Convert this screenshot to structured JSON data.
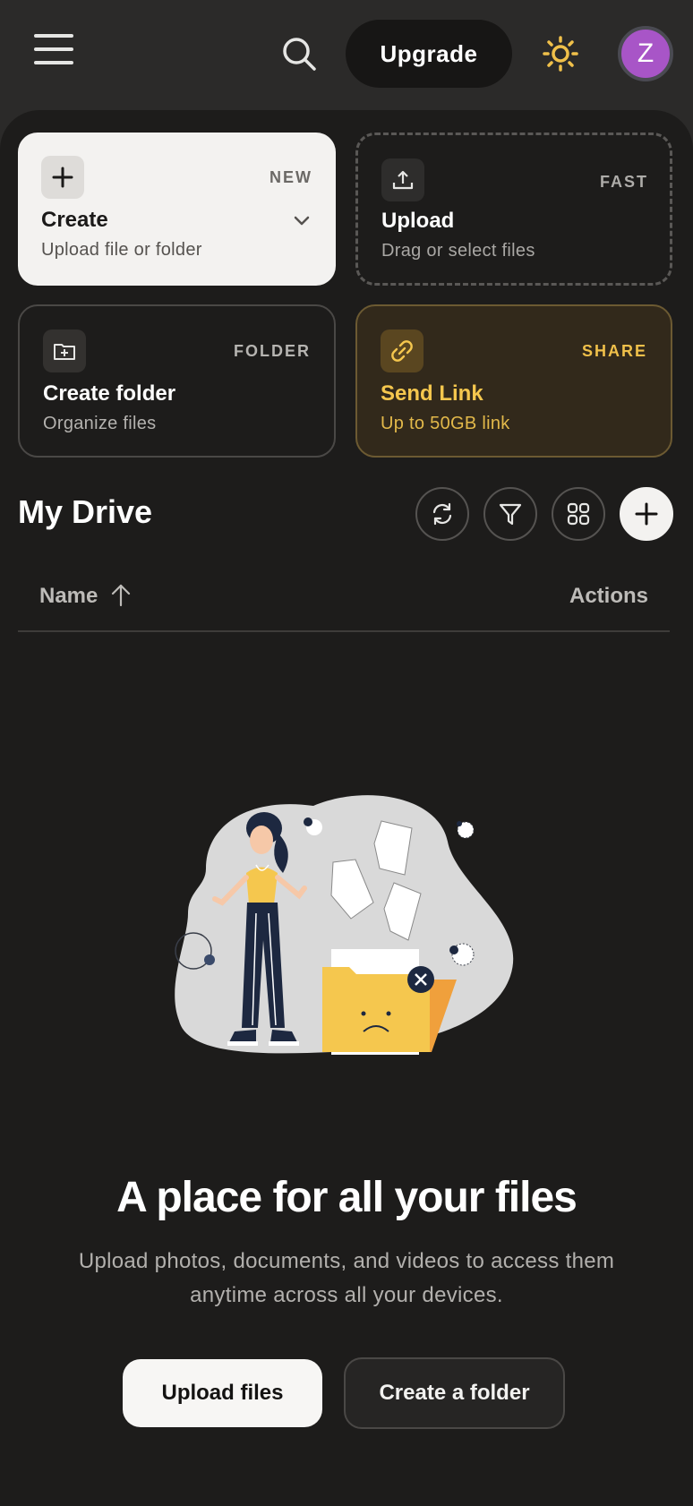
{
  "header": {
    "upgrade_label": "Upgrade",
    "avatar_initial": "Z"
  },
  "cards": {
    "create": {
      "title": "Create",
      "subtitle": "Upload file or folder",
      "tag": "NEW"
    },
    "upload": {
      "title": "Upload",
      "subtitle": "Drag or select files",
      "tag": "FAST"
    },
    "folder": {
      "title": "Create folder",
      "subtitle": "Organize files",
      "tag": "FOLDER"
    },
    "link": {
      "title": "Send Link",
      "subtitle": "Up to 50GB link",
      "tag": "SHARE"
    }
  },
  "drive": {
    "title": "My Drive",
    "columns": {
      "name": "Name",
      "actions": "Actions"
    }
  },
  "empty_state": {
    "title": "A place for all your files",
    "subtitle": "Upload photos, documents, and videos to access them anytime across all your devices.",
    "primary_button": "Upload files",
    "secondary_button": "Create a folder"
  },
  "colors": {
    "background": "#1d1c1b",
    "accent_gold": "#f5c74e",
    "avatar": "#a855c7"
  },
  "icons": [
    "menu-icon",
    "search-icon",
    "sun-icon",
    "plus-icon",
    "chevron-down-icon",
    "upload-icon",
    "folder-plus-icon",
    "link-icon",
    "refresh-icon",
    "filter-icon",
    "grid-icon",
    "arrow-up-icon"
  ]
}
